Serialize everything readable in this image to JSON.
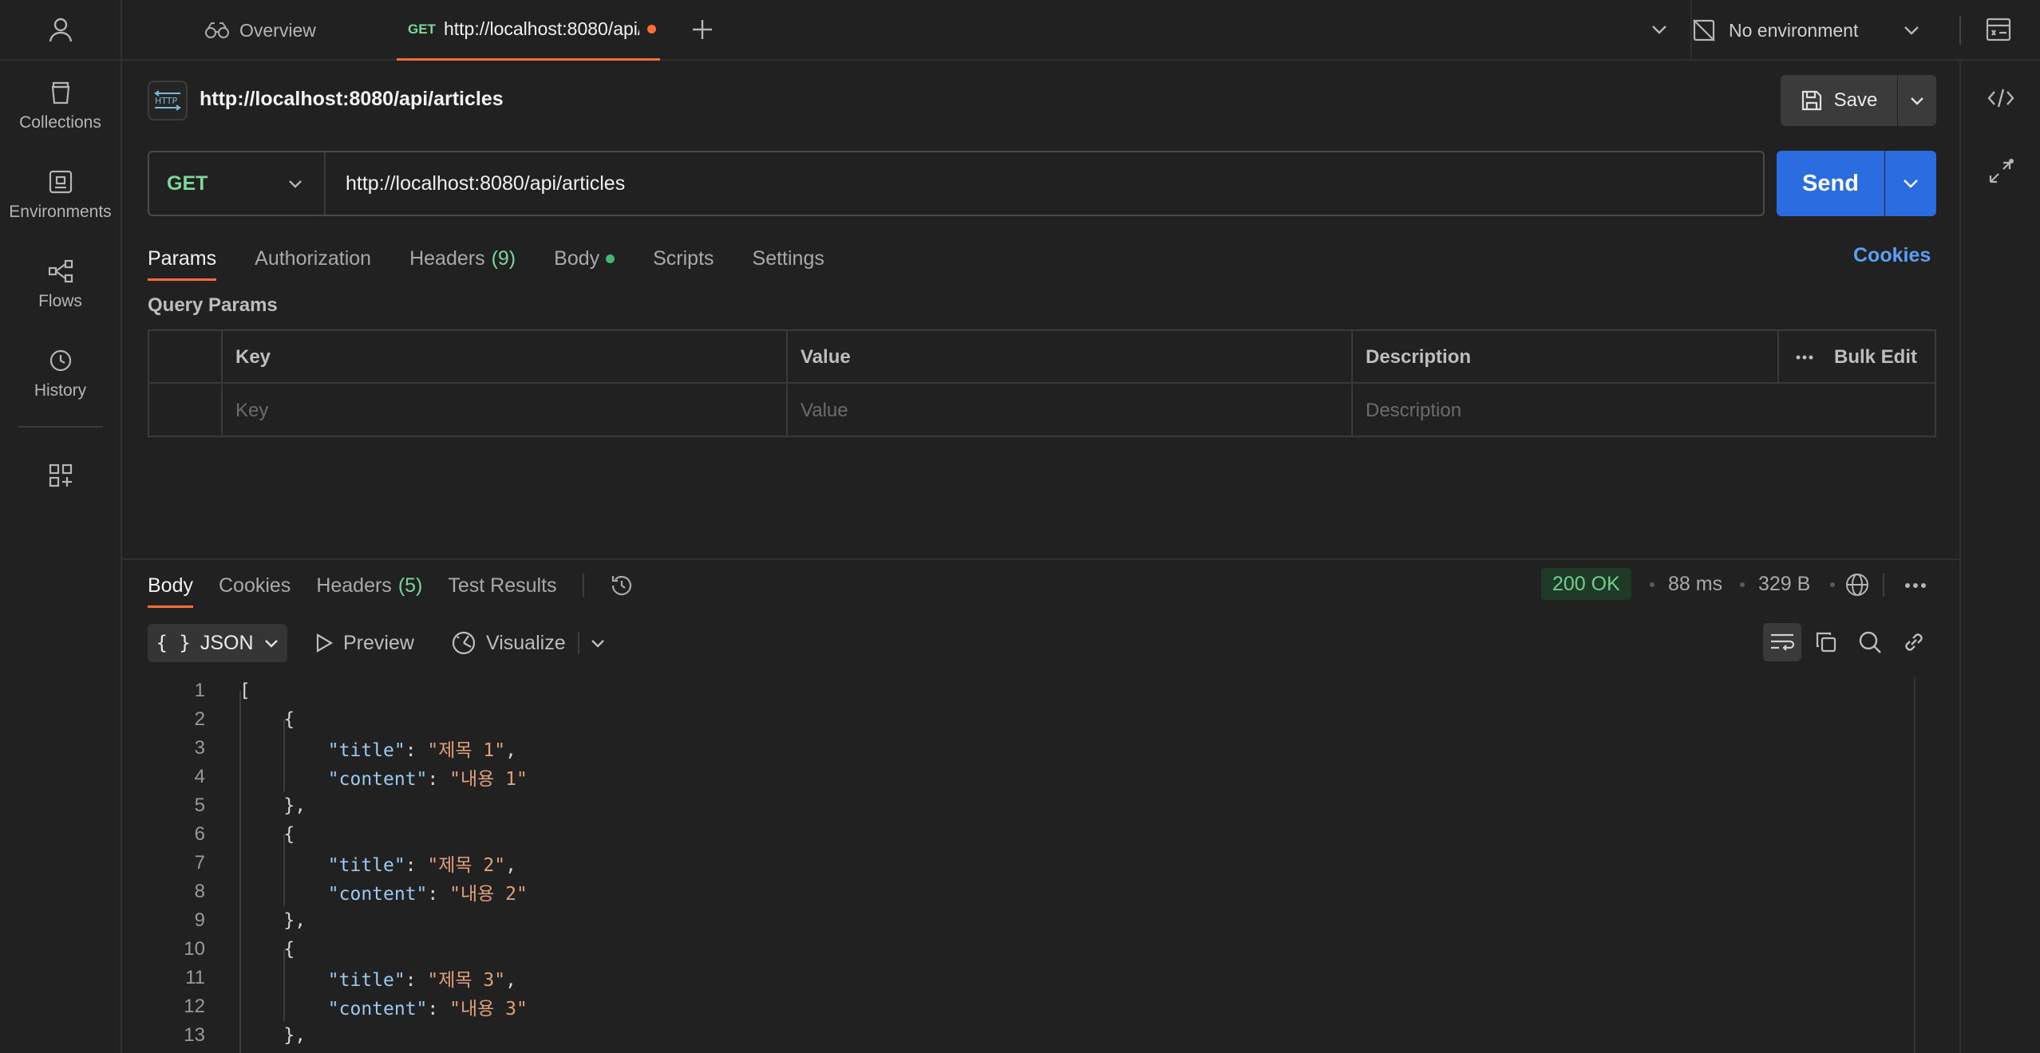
{
  "rail": {
    "items": [
      {
        "label": "Collections",
        "icon": "collections-icon"
      },
      {
        "label": "Environments",
        "icon": "environments-icon"
      },
      {
        "label": "Flows",
        "icon": "flows-icon"
      },
      {
        "label": "History",
        "icon": "history-icon"
      }
    ]
  },
  "tabs": {
    "overview": "Overview",
    "active": {
      "method": "GET",
      "url": "http://localhost:8080/api/articles"
    }
  },
  "environment": {
    "label": "No environment"
  },
  "request": {
    "title": "http://localhost:8080/api/articles",
    "method": "GET",
    "url": "http://localhost:8080/api/articles",
    "save_label": "Save",
    "send_label": "Send",
    "tabs": [
      {
        "label": "Params"
      },
      {
        "label": "Authorization"
      },
      {
        "label": "Headers",
        "count": "(9)"
      },
      {
        "label": "Body"
      },
      {
        "label": "Scripts"
      },
      {
        "label": "Settings"
      }
    ],
    "cookies_label": "Cookies",
    "query_params_title": "Query Params",
    "params_table": {
      "headers": [
        "Key",
        "Value",
        "Description"
      ],
      "placeholders": [
        "Key",
        "Value",
        "Description"
      ],
      "bulk_edit": "Bulk Edit"
    }
  },
  "response": {
    "tabs": [
      {
        "label": "Body"
      },
      {
        "label": "Cookies"
      },
      {
        "label": "Headers",
        "count": "(5)"
      },
      {
        "label": "Test Results"
      }
    ],
    "status": "200 OK",
    "time": "88 ms",
    "size": "329 B",
    "format": "JSON",
    "preview_label": "Preview",
    "visualize_label": "Visualize",
    "lines": [
      {
        "n": "1",
        "text": "["
      },
      {
        "n": "2",
        "text": "    {"
      },
      {
        "n": "3",
        "key": "\"title\"",
        "val": "\"제목 1\"",
        "indent": "        "
      },
      {
        "n": "4",
        "key": "\"content\"",
        "val": "\"내용 1\"",
        "indent": "        "
      },
      {
        "n": "5",
        "text": "    },"
      },
      {
        "n": "6",
        "text": "    {"
      },
      {
        "n": "7",
        "key": "\"title\"",
        "val": "\"제목 2\"",
        "indent": "        "
      },
      {
        "n": "8",
        "key": "\"content\"",
        "val": "\"내용 2\"",
        "indent": "        "
      },
      {
        "n": "9",
        "text": "    },"
      },
      {
        "n": "10",
        "text": "    {"
      },
      {
        "n": "11",
        "key": "\"title\"",
        "val": "\"제목 3\"",
        "indent": "        "
      },
      {
        "n": "12",
        "key": "\"content\"",
        "val": "\"내용 3\"",
        "indent": "        "
      },
      {
        "n": "13",
        "text": "    },"
      }
    ]
  },
  "colors": {
    "accent": "#ff6c37",
    "send": "#2b6ce0",
    "method": "#7ed79a",
    "link": "#5b9ef5"
  }
}
